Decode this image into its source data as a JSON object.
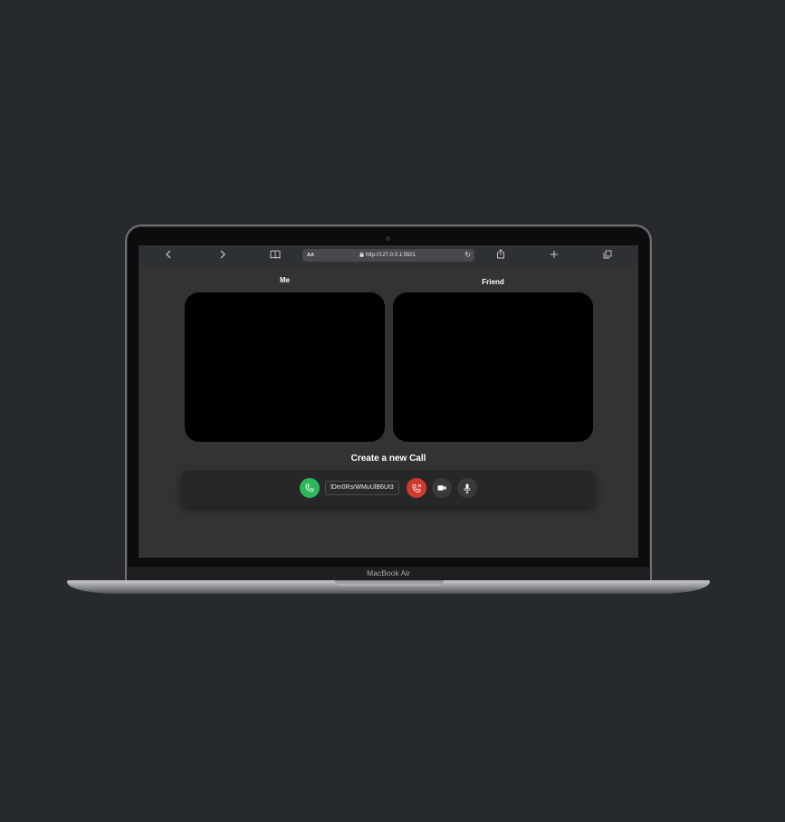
{
  "browser": {
    "url_aa": "AA",
    "url": "http://127.0.0.1:5501",
    "icons": [
      "back-icon",
      "forward-icon",
      "bookmarks-icon",
      "lock-icon",
      "reload-icon",
      "share-icon",
      "new-tab-icon",
      "tabs-icon"
    ]
  },
  "videos": {
    "me_label": "Me",
    "friend_label": "Friend"
  },
  "call": {
    "title": "Create a new Call",
    "call_id": "lDm0RsrWMuUlB6Ut3",
    "colors": {
      "call": "#2fb55c",
      "hangup": "#cf3a2f"
    }
  },
  "laptop": {
    "model": "MacBook Air"
  }
}
